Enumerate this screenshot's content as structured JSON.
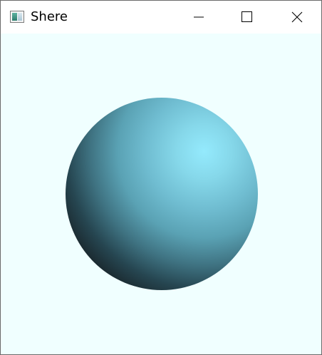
{
  "window": {
    "title": "Shere",
    "icon": "application-icon",
    "controls": {
      "minimize_icon": "minimize-icon",
      "maximize_icon": "maximize-icon",
      "close_icon": "close-icon"
    }
  },
  "canvas": {
    "background_color": "#f0ffff",
    "sphere_highlight_color": "#94eafd",
    "sphere_shadow_color": "#1b2a30"
  }
}
